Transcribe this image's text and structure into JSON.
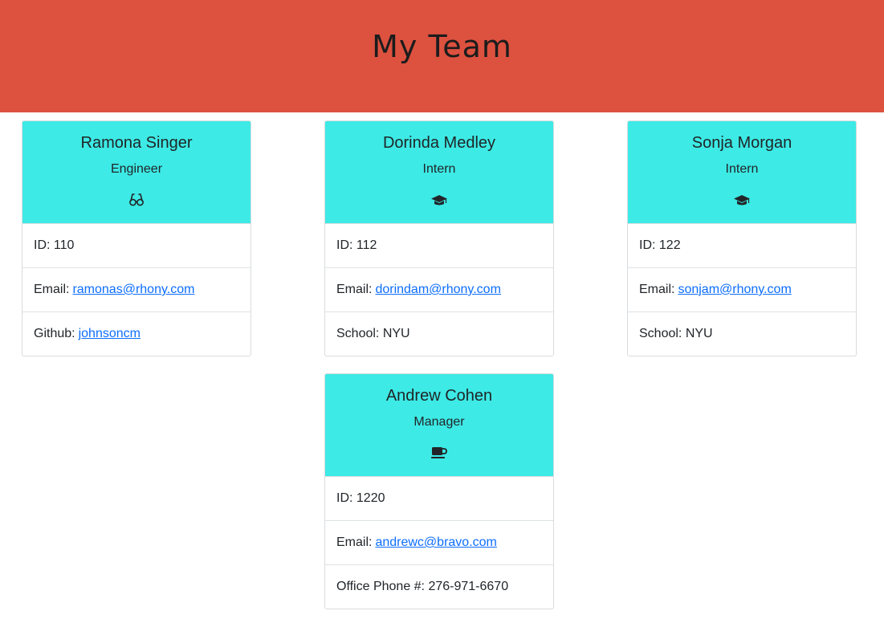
{
  "header": {
    "title": "My Team"
  },
  "cards": [
    {
      "name": "Ramona Singer",
      "role": "Engineer",
      "icon": "glasses-icon",
      "id_label": "ID:",
      "id": "110",
      "email_label": "Email:",
      "email": "ramonas@rhony.com",
      "extra_label": "Github:",
      "extra_value": "johnsoncm"
    },
    {
      "name": "Dorinda Medley",
      "role": "Intern",
      "icon": "graduation-cap-icon",
      "id_label": "ID:",
      "id": "112",
      "email_label": "Email:",
      "email": "dorindam@rhony.com",
      "extra_label": "School:",
      "extra_value": "NYU"
    },
    {
      "name": "Sonja Morgan",
      "role": "Intern",
      "icon": "graduation-cap-icon",
      "id_label": "ID:",
      "id": "122",
      "email_label": "Email:",
      "email": "sonjam@rhony.com",
      "extra_label": "School:",
      "extra_value": "NYU"
    },
    {
      "name": "Andrew Cohen",
      "role": "Manager",
      "icon": "coffee-mug-icon",
      "id_label": "ID:",
      "id": "1220",
      "email_label": "Email:",
      "email": "andrewc@bravo.com",
      "extra_label": "Office Phone #:",
      "extra_value": "276-971-6670"
    }
  ],
  "colors": {
    "header_bg": "#dd513f",
    "card_header_bg": "#3deae5",
    "link": "#0d6efd"
  }
}
